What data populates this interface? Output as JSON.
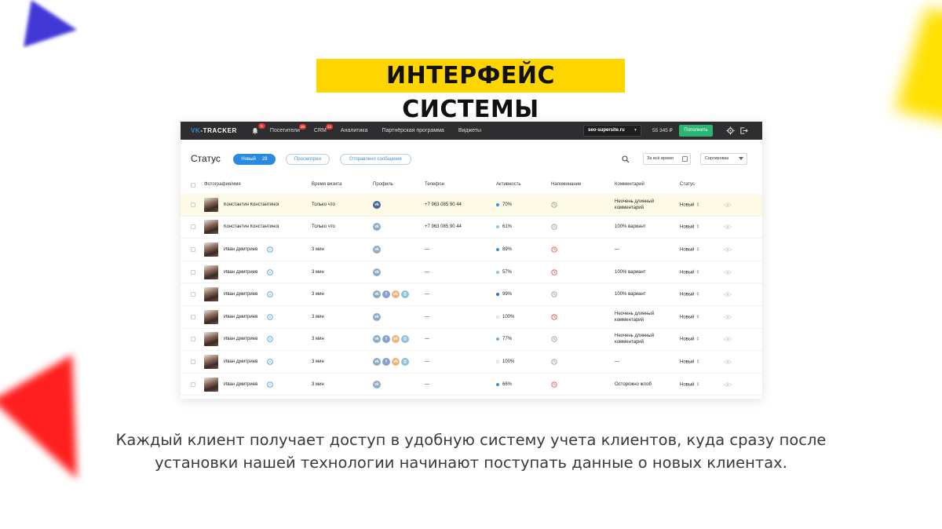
{
  "page": {
    "title": "ИНТЕРФЕЙС СИСТЕМЫ",
    "caption_line1": "Каждый клиент получает доступ в удобную систему учета клиентов, куда сразу после",
    "caption_line2": "установки нашей технологии начинают поступать данные о новых клиентах."
  },
  "colors": {
    "accent_yellow": "#ffd500",
    "topbar": "#2e2e30",
    "primary_blue": "#2a8ae0",
    "green": "#2bb673",
    "badge_red": "#e53935"
  },
  "topbar": {
    "logo_vk": "VK",
    "logo_rest": "-TRACKER",
    "bell_badge": "5",
    "nav": [
      {
        "label": "Посетители",
        "badge": "28"
      },
      {
        "label": "CRM",
        "badge": "12"
      },
      {
        "label": "Аналитика"
      },
      {
        "label": "Партнёрская программа"
      },
      {
        "label": "Виджеты"
      }
    ],
    "site": "seo-supersite.ru",
    "balance": "55 345 ₽",
    "topup_label": "Пополнить"
  },
  "statusbar": {
    "title": "Статус",
    "tabs": [
      {
        "label": "Новый",
        "count": "28",
        "active": true
      },
      {
        "label": "Просмотрен"
      },
      {
        "label": "Отправлено сообщение"
      }
    ],
    "date_filter": "За всё время",
    "sort_label": "Сортировка"
  },
  "table": {
    "headers": [
      "Фотография/имя",
      "Время визита",
      "Профиль",
      "Телефон",
      "Активность",
      "Напоминание",
      "Комментарий",
      "Статус"
    ],
    "rows": [
      {
        "name": "Константин Константинов",
        "visit": "Только что",
        "profiles": [
          "vk"
        ],
        "phone": "+7 963 085 90 44",
        "activity": "70%",
        "dot": "#3a8fd8",
        "remind_color": "#999999",
        "comment": "Неочень длинный комментарий",
        "status": "Новый",
        "highlight": true,
        "chat": false
      },
      {
        "name": "Константин Константинов",
        "visit": "Только что",
        "profiles": [
          "vk"
        ],
        "phone": "+7 963 085 90 44",
        "activity": "61%",
        "dot": "#8cc4ea",
        "remind_color": "#999999",
        "comment": "100% вариант",
        "status": "Новый",
        "chat": false
      },
      {
        "name": "Иван Дмитриев",
        "visit": "3 мин",
        "profiles": [
          "vk"
        ],
        "phone": "—",
        "activity": "89%",
        "dot": "#3a8fd8",
        "remind_color": "#e05050",
        "comment": "—",
        "status": "Новый",
        "chat": true
      },
      {
        "name": "Иван Дмитриев",
        "visit": "3 мин",
        "profiles": [
          "vk"
        ],
        "phone": "—",
        "activity": "57%",
        "dot": "#8cc4ea",
        "remind_color": "#e05050",
        "comment": "100% вариант",
        "status": "Новый",
        "chat": true
      },
      {
        "name": "Иван Дмитриев",
        "visit": "3 мин",
        "profiles": [
          "vk",
          "fb",
          "ok",
          "ml"
        ],
        "phone": "—",
        "activity": "99%",
        "dot": "#1d7bd0",
        "remind_color": "#999999",
        "comment": "100% вариант",
        "status": "Новый",
        "chat": true
      },
      {
        "name": "Иван Дмитриев",
        "visit": "3 мин",
        "profiles": [
          "vk"
        ],
        "phone": "—",
        "activity": "100%",
        "dot": "#ffffff",
        "remind_color": "#e05050",
        "comment": "Неочень длинный комментарий",
        "status": "Новый",
        "chat": true
      },
      {
        "name": "Иван Дмитриев",
        "visit": "3 мин",
        "profiles": [
          "vk",
          "fb",
          "ok",
          "ml"
        ],
        "phone": "—",
        "activity": "77%",
        "dot": "#6cb2e6",
        "remind_color": "#999999",
        "comment": "Неочень длинный комментарий",
        "status": "Новый",
        "chat": true
      },
      {
        "name": "Иван Дмитриев",
        "visit": "3 мин",
        "profiles": [
          "vk",
          "fb",
          "ok",
          "ml"
        ],
        "phone": "—",
        "activity": "100%",
        "dot": "#ffffff",
        "remind_color": "#999999",
        "comment": "—",
        "status": "Новый",
        "chat": true
      },
      {
        "name": "Иван Дмитриев",
        "visit": "3 мин",
        "profiles": [
          "vk"
        ],
        "phone": "—",
        "activity": "66%",
        "dot": "#3a8fd8",
        "remind_color": "#e05050",
        "comment": "Осторожно жлоб",
        "status": "Новый",
        "chat": true
      }
    ]
  }
}
